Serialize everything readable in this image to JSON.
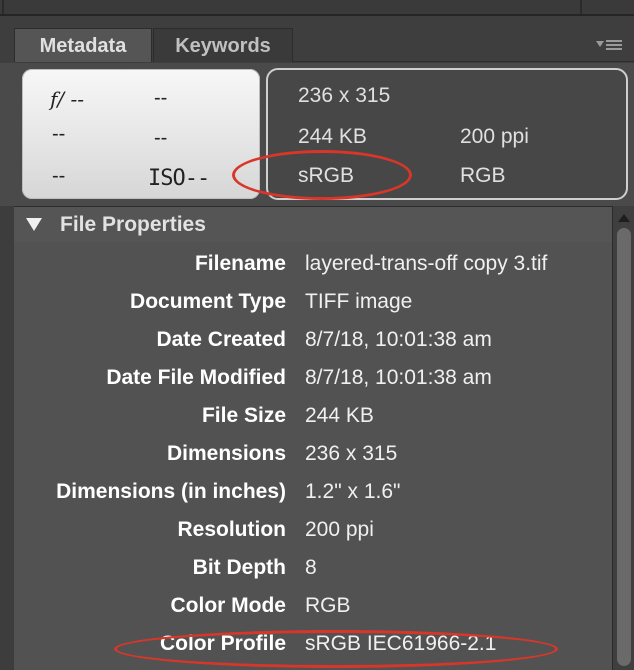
{
  "tabs": {
    "metadata": "Metadata",
    "keywords": "Keywords"
  },
  "exif": {
    "aperture": "f/ --",
    "shutter": "--",
    "exposure_comp": "--",
    "metering": "--",
    "white_balance": "--",
    "iso": "ISO--"
  },
  "summary": {
    "dimensions": "236 x 315",
    "file_size": "244 KB",
    "resolution": "200 ppi",
    "color_profile": "sRGB",
    "color_mode": "RGB"
  },
  "file_properties": {
    "title": "File Properties",
    "rows": [
      {
        "label": "Filename",
        "value": "layered-trans-off copy 3.tif"
      },
      {
        "label": "Document Type",
        "value": "TIFF image"
      },
      {
        "label": "Date Created",
        "value": "8/7/18, 10:01:38 am"
      },
      {
        "label": "Date File Modified",
        "value": "8/7/18, 10:01:38 am"
      },
      {
        "label": "File Size",
        "value": "244 KB"
      },
      {
        "label": "Dimensions",
        "value": "236 x 315"
      },
      {
        "label": "Dimensions (in inches)",
        "value": "1.2\" x 1.6\""
      },
      {
        "label": "Resolution",
        "value": "200 ppi"
      },
      {
        "label": "Bit Depth",
        "value": "8"
      },
      {
        "label": "Color Mode",
        "value": "RGB"
      },
      {
        "label": "Color Profile",
        "value": "sRGB IEC61966-2.1"
      }
    ]
  },
  "colors": {
    "annotation": "#d9362a",
    "panel": "#525252"
  }
}
